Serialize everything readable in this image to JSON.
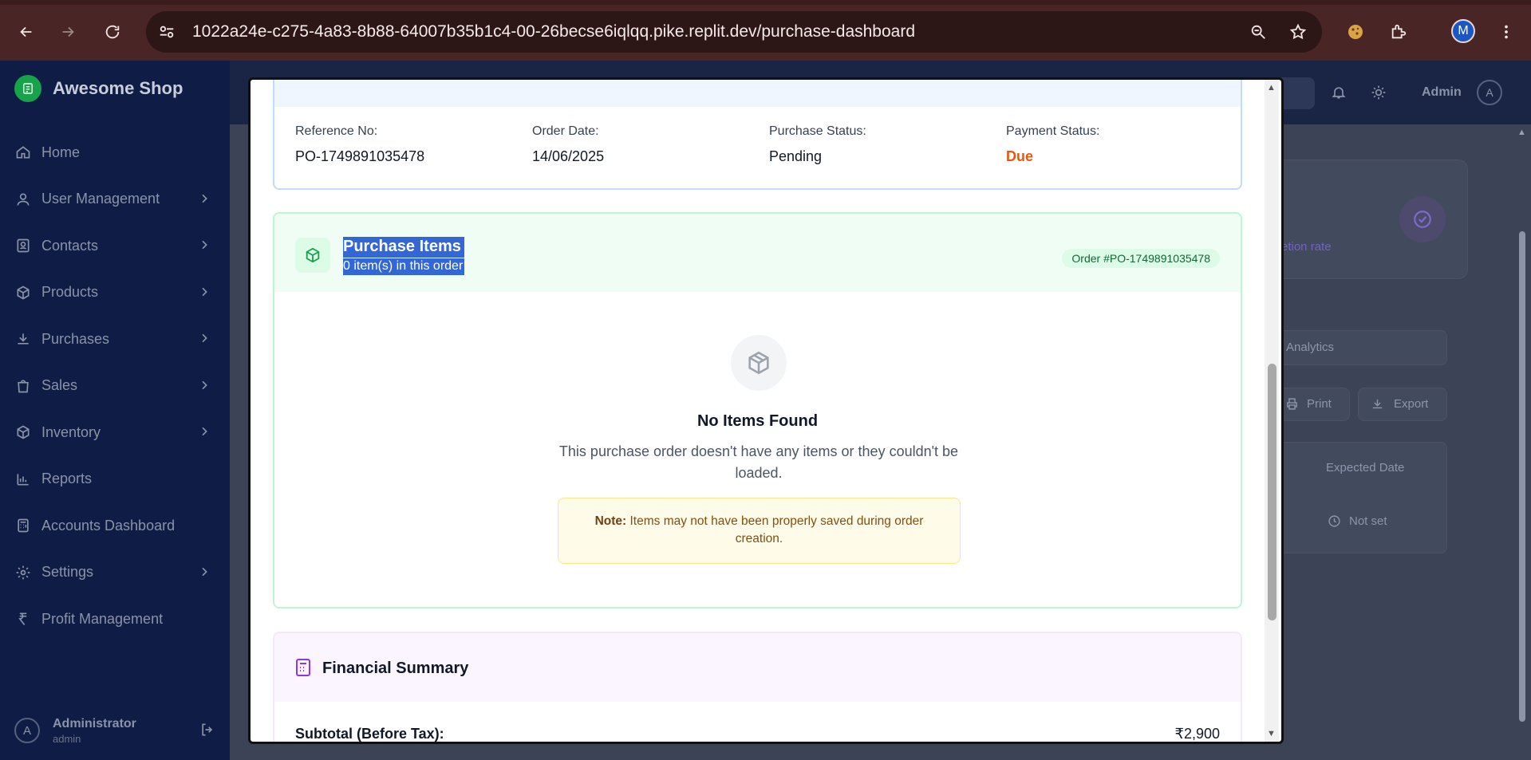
{
  "browser": {
    "url_host": "1022a24e-c275-4a83-8b88-64007b35b1c4-00-26becse6iqlqq.pike.replit.dev",
    "url_path": "/purchase-dashboard",
    "profile_initial": "M"
  },
  "app": {
    "brand": "Awesome Shop",
    "nav": [
      {
        "label": "Home",
        "icon": "home-icon",
        "has_chevron": false
      },
      {
        "label": "User Management",
        "icon": "user-icon",
        "has_chevron": true
      },
      {
        "label": "Contacts",
        "icon": "contacts-icon",
        "has_chevron": true
      },
      {
        "label": "Products",
        "icon": "box-icon",
        "has_chevron": true
      },
      {
        "label": "Purchases",
        "icon": "download-icon",
        "has_chevron": true
      },
      {
        "label": "Sales",
        "icon": "shopping-bag-icon",
        "has_chevron": true
      },
      {
        "label": "Inventory",
        "icon": "box-icon",
        "has_chevron": true
      },
      {
        "label": "Reports",
        "icon": "bar-chart-icon",
        "has_chevron": false
      },
      {
        "label": "Accounts Dashboard",
        "icon": "calculator-icon",
        "has_chevron": false
      },
      {
        "label": "Settings",
        "icon": "gear-icon",
        "has_chevron": true
      },
      {
        "label": "Profit Management",
        "icon": "rupee-icon",
        "has_chevron": false
      }
    ],
    "user": {
      "name": "Administrator",
      "role": "admin",
      "initial": "A"
    },
    "topbar": {
      "admin_label": "Admin",
      "admin_initial": "A"
    },
    "background": {
      "completion_rate": "etion rate",
      "analytics_tab": "Analytics",
      "print_button": "Print",
      "export_button": "Export",
      "expected_date_header": "Expected Date",
      "not_set": "Not set"
    }
  },
  "modal": {
    "order_info": {
      "reference_label": "Reference No:",
      "reference_value": "PO-1749891035478",
      "order_date_label": "Order Date:",
      "order_date_value": "14/06/2025",
      "purchase_status_label": "Purchase Status:",
      "purchase_status_value": "Pending",
      "payment_status_label": "Payment Status:",
      "payment_status_value": "Due"
    },
    "items": {
      "title": "Purchase Items",
      "subtitle": "0 item(s) in this order",
      "order_badge": "Order #PO-1749891035478",
      "empty_title": "No Items Found",
      "empty_desc": "This purchase order doesn't have any items or they couldn't be loaded.",
      "note_label": "Note:",
      "note_text": " Items may not have been properly saved during order creation."
    },
    "financial": {
      "title": "Financial Summary",
      "subtotal_label": "Subtotal (Before Tax):",
      "subtotal_value": "₹2,900"
    }
  },
  "colors": {
    "sidebar_bg": "#0f1c45",
    "due_color": "#ea580c",
    "selection": "#3367d6"
  }
}
